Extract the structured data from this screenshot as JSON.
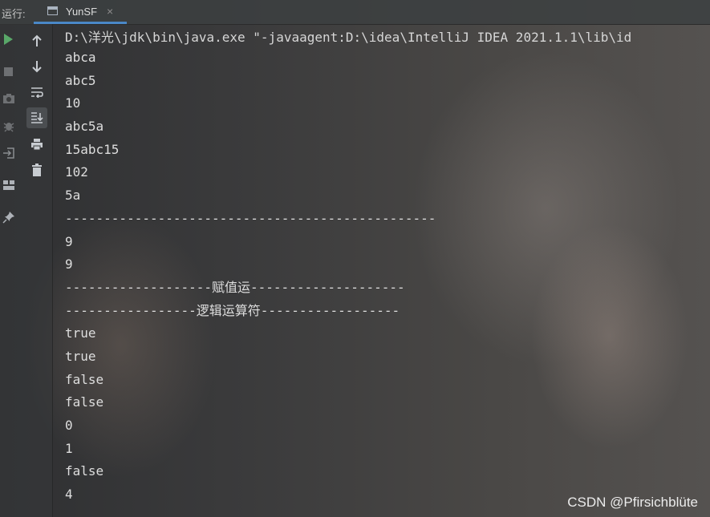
{
  "header": {
    "run_label": "运行:",
    "tab_label": "YunSF",
    "tab_close": "×"
  },
  "console": {
    "command": "D:\\洋光\\jdk\\bin\\java.exe \"-javaagent:D:\\idea\\IntelliJ IDEA 2021.1.1\\lib\\id",
    "lines": [
      "abca",
      "abc5",
      "10",
      "abc5a",
      "15abc15",
      "102",
      "5a",
      "------------------------------------------------",
      "9",
      "9",
      "-------------------赋值运--------------------",
      "-----------------逻辑运算符------------------",
      "true",
      "true",
      "false",
      "false",
      "0",
      "1",
      "false",
      "4"
    ]
  },
  "watermark": "CSDN @Pfirsichblüte",
  "icons": [
    "play-icon",
    "stop-icon",
    "camera-icon",
    "bug-icon",
    "login-icon",
    "layout-icon",
    "pin-icon",
    "arrow-up-icon",
    "arrow-down-icon",
    "soft-wrap-icon",
    "scroll-to-end-icon",
    "print-icon",
    "trash-icon"
  ]
}
